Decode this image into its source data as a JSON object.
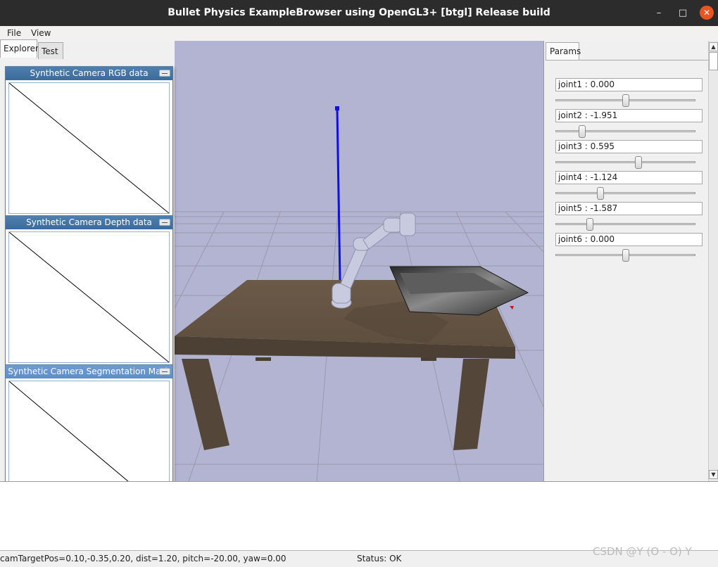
{
  "window": {
    "title": "Bullet Physics ExampleBrowser using OpenGL3+ [btgl] Release build",
    "minimize_glyph": "–",
    "maximize_glyph": "□",
    "close_glyph": "✕"
  },
  "menu": {
    "file": "File",
    "view": "View"
  },
  "left_tabs": {
    "explorer": "Explorer",
    "test": "Test"
  },
  "camera_windows": [
    {
      "title": "Synthetic Camera RGB data"
    },
    {
      "title": "Synthetic Camera Depth data"
    },
    {
      "title": "Synthetic Camera Segmentation Mask"
    }
  ],
  "params": {
    "tab_label": "Params",
    "joints": [
      {
        "label": "joint1 : 0.000",
        "value": 0.0
      },
      {
        "label": "joint2 : -1.951",
        "value": -1.951
      },
      {
        "label": "joint3 : 0.595",
        "value": 0.595
      },
      {
        "label": "joint4 : -1.124",
        "value": -1.124
      },
      {
        "label": "joint5 : -1.587",
        "value": -1.587
      },
      {
        "label": "joint6 : 0.000",
        "value": 0.0
      }
    ]
  },
  "status": {
    "camera": "camTargetPos=0.10,-0.35,0.20, dist=1.20, pitch=-20.00, yaw=0.00",
    "status": "Status: OK"
  },
  "watermark": "CSDN @Y (O - O) Y",
  "colors": {
    "titlebar": "#2c2c2c",
    "close_button": "#e95420",
    "viewport_bg": "#b3b3d2",
    "camera_header": "#3a6b9c",
    "axis_blue": "#1010e0"
  }
}
